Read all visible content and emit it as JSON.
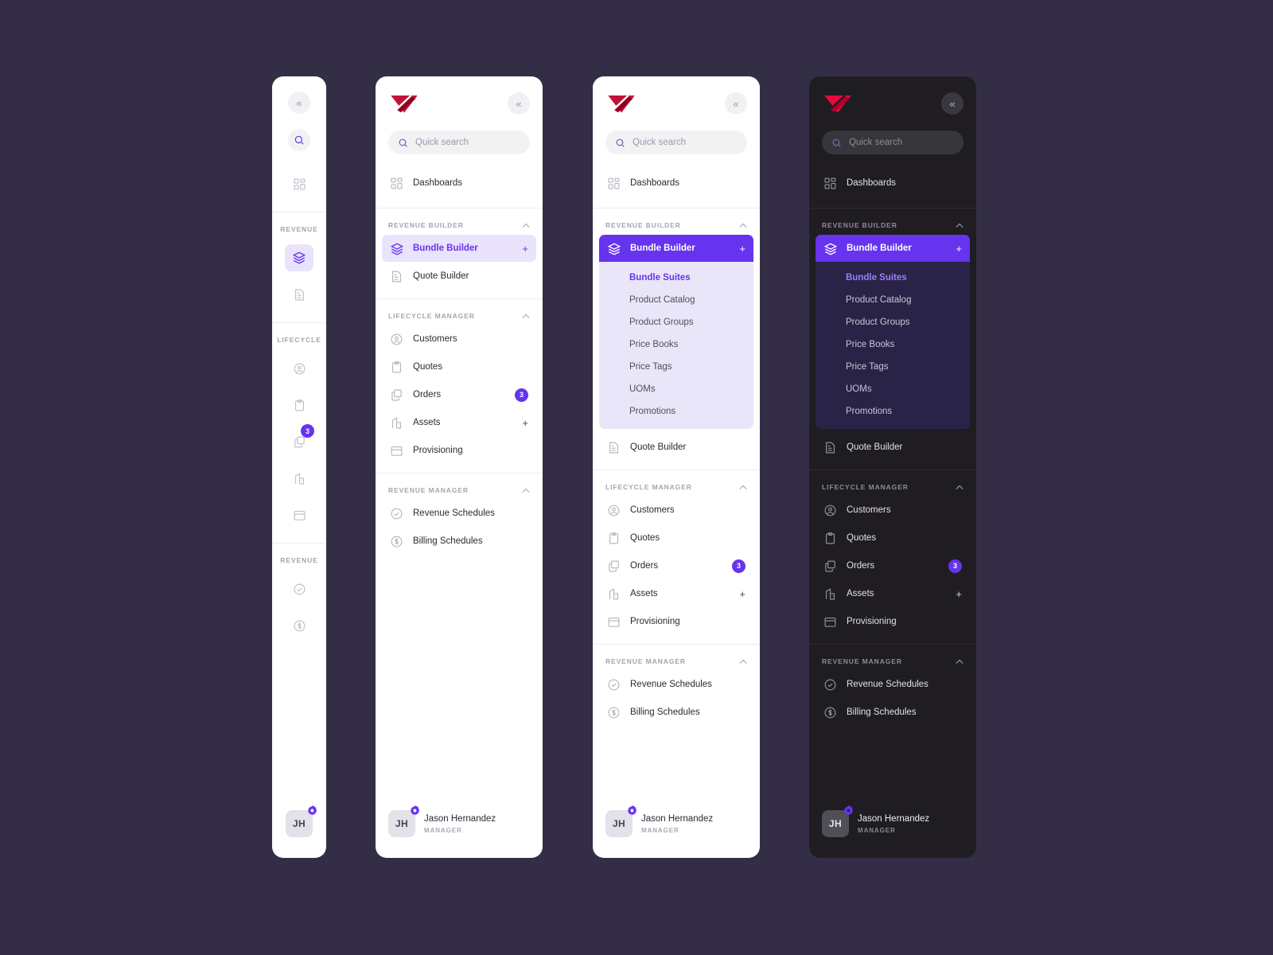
{
  "theme": {
    "page_bg": "#332E45",
    "accent": "#6633EE",
    "accent_soft": "#E9E3FB",
    "submenu_light_bg": "#EAE6FA",
    "submenu_dark_bg": "#2A2348",
    "panel_dark_bg": "#1F1D21",
    "logo_red": "#C0123A",
    "badge_bg": "#6633EE"
  },
  "icons": {
    "collapse": "chevron-double-left-icon",
    "search": "search-icon",
    "dashboards": "grid-icon",
    "bundle_builder": "layers-icon",
    "quote_builder": "document-lines-icon",
    "customers": "user-circle-icon",
    "quotes": "clipboard-icon",
    "orders": "copy-stack-icon",
    "assets": "building-icon",
    "provisioning": "archive-box-icon",
    "revenue_schedules": "check-circle-icon",
    "billing_schedules": "dollar-circle-icon",
    "gear": "gear-icon",
    "chevron_up": "chevron-up-icon",
    "plus": "plus-icon"
  },
  "search": {
    "placeholder": "Quick search"
  },
  "collapse_label": "«",
  "chevron_up": "˄",
  "plus_label": "+",
  "top_nav": {
    "dashboards": "Dashboards"
  },
  "sections": {
    "revenue_builder": {
      "title": "REVENUE BUILDER",
      "rail_title": "REVENUE",
      "items": [
        {
          "label": "Bundle Builder",
          "trailing": "+",
          "state": "active"
        },
        {
          "label": "Quote Builder",
          "trailing": "",
          "state": "default"
        }
      ],
      "submenu": [
        {
          "label": "Bundle Suites",
          "current": true
        },
        {
          "label": "Product Catalog",
          "current": false
        },
        {
          "label": "Product Groups",
          "current": false
        },
        {
          "label": "Price Books",
          "current": false
        },
        {
          "label": "Price Tags",
          "current": false
        },
        {
          "label": "UOMs",
          "current": false
        },
        {
          "label": "Promotions",
          "current": false
        }
      ]
    },
    "lifecycle_manager": {
      "title": "LIFECYCLE MANAGER",
      "rail_title": "LIFECYCLE",
      "items": [
        {
          "label": "Customers",
          "trailing": "",
          "badge": ""
        },
        {
          "label": "Quotes",
          "trailing": "",
          "badge": ""
        },
        {
          "label": "Orders",
          "trailing": "",
          "badge": "3"
        },
        {
          "label": "Assets",
          "trailing": "+",
          "badge": ""
        },
        {
          "label": "Provisioning",
          "trailing": "",
          "badge": ""
        }
      ]
    },
    "revenue_manager": {
      "title": "REVENUE MANAGER",
      "rail_title": "REVENUE",
      "items": [
        {
          "label": "Revenue Schedules"
        },
        {
          "label": "Billing Schedules"
        }
      ]
    }
  },
  "profile": {
    "initials": "JH",
    "name": "Jason Hernandez",
    "role": "MANAGER"
  }
}
